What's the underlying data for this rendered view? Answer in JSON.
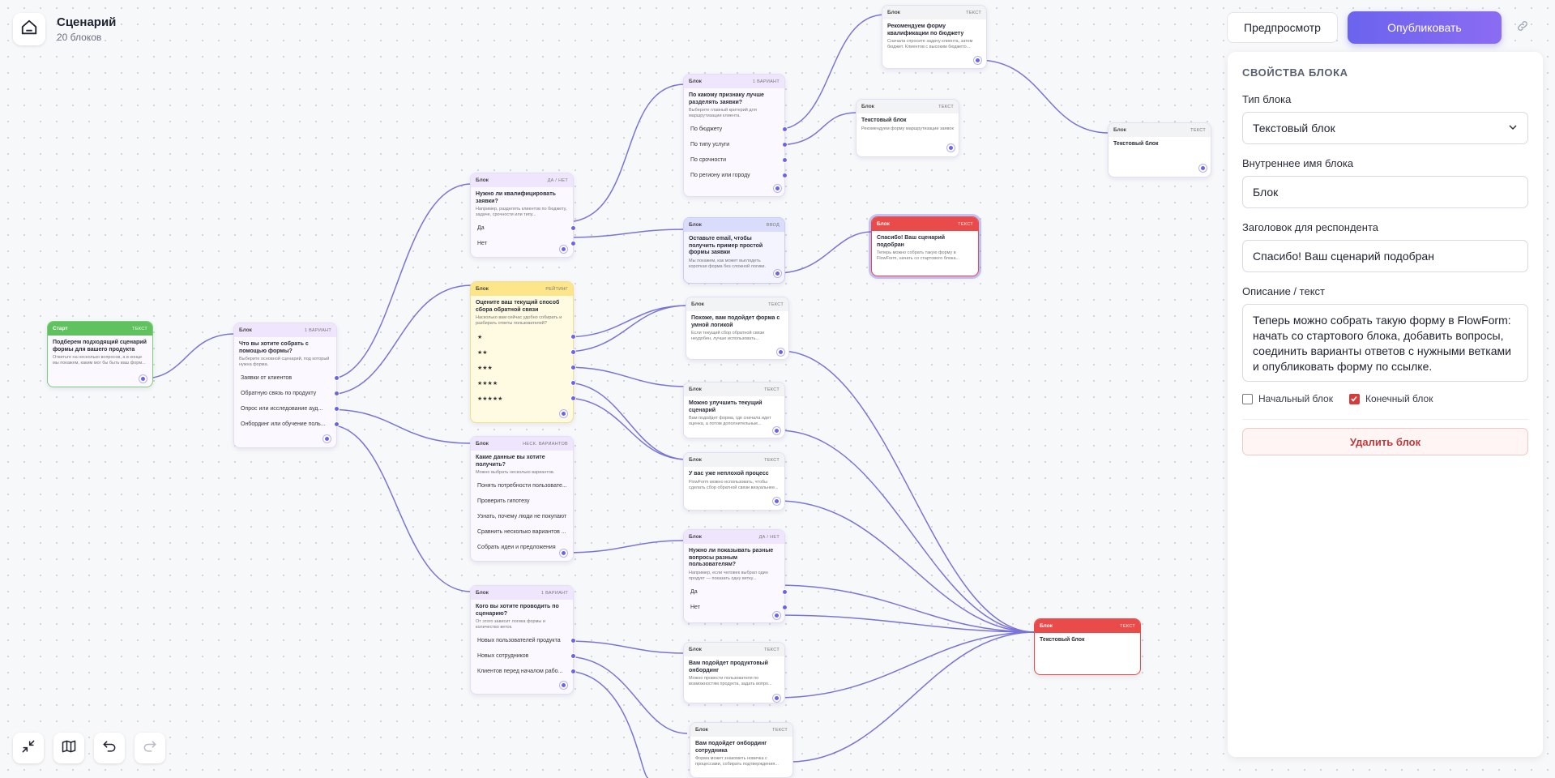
{
  "header": {
    "title": "Сценарий",
    "subtitle": "20 блоков"
  },
  "actions": {
    "preview": "Предпросмотр",
    "publish": "Опубликовать"
  },
  "panel": {
    "title": "СВОЙСТВА БЛОКА",
    "type_label": "Тип блока",
    "type_value": "Текстовый блок",
    "internal_label": "Внутреннее имя блока",
    "internal_value": "Блок",
    "heading_label": "Заголовок для респондента",
    "heading_value": "Спасибо! Ваш сценарий подобран",
    "desc_label": "Описание / текст",
    "desc_value": "Теперь можно собрать такую форму в FlowForm: начать со стартового блока, добавить вопросы, соединить варианты ответов с нужными ветками и опубликовать форму по ссылке.",
    "start_label": "Начальный блок",
    "end_label": "Конечный блок",
    "start_checked": false,
    "end_checked": true,
    "delete_label": "Удалить блок"
  },
  "colors": {
    "accent": "#6b63ee",
    "danger": "#e94b4b",
    "start": "#5fc25f"
  },
  "nodes": {
    "n_start": {
      "badge": "Старт",
      "tag": "ТЕКСТ",
      "q": "Подберем подходящий сценарий формы для вашего продукта",
      "d": "Ответьте на несколько вопросов, а в конце мы покажем, каким мог бы быть ваш форм..."
    },
    "n1": {
      "badge": "Блок",
      "tag": "1 ВАРИАНТ",
      "q": "Что вы хотите собрать с помощью формы?",
      "d": "Выберите основной сценарий, под который нужна форма.",
      "opts": [
        "Заявки от клиентов",
        "Обратную связь по продукту",
        "Опрос или исследование ауд...",
        "Онбординг или обучение поль..."
      ]
    },
    "n2": {
      "badge": "Блок",
      "tag": "ДА / НЕТ",
      "q": "Нужно ли квалифицировать заявки?",
      "d": "Например, разделять клиентов по бюджету, задаче, срочности или типу...",
      "opts": [
        "Да",
        "Нет"
      ]
    },
    "n3": {
      "badge": "Блок",
      "tag": "РЕЙТИНГ",
      "q": "Оцените ваш текущий способ сбора обратной связи",
      "d": "Насколько вам сейчас удобно собирать и разбирать ответы пользователей?",
      "opts": [
        "★",
        "★★",
        "★★★",
        "★★★★",
        "★★★★★"
      ]
    },
    "n4": {
      "badge": "Блок",
      "tag": "НЕСК. ВАРИАНТОВ",
      "q": "Какие данные вы хотите получить?",
      "d": "Можно выбрать несколько вариантов.",
      "opts": [
        "Понять потребности пользовате...",
        "Проверить гипотезу",
        "Узнать, почему люди не покупают",
        "Сравнить несколько вариантов ...",
        "Собрать идеи и предложения"
      ]
    },
    "n5": {
      "badge": "Блок",
      "tag": "1 ВАРИАНТ",
      "q": "Кого вы хотите проводить по сценарию?",
      "d": "От этого зависит логика формы и количество веток.",
      "opts": [
        "Новых пользователей продукта",
        "Новых сотрудников",
        "Клиентов перед началом рабо..."
      ]
    },
    "n6": {
      "badge": "Блок",
      "tag": "1 ВАРИАНТ",
      "q": "По какому признаку лучше разделять заявки?",
      "d": "Выберите главный критерий для маршрутизации клиента.",
      "opts": [
        "По бюджету",
        "По типу услуги",
        "По срочности",
        "По региону или городу"
      ]
    },
    "n7": {
      "badge": "Блок",
      "tag": "ВВОД",
      "q": "Оставьте email, чтобы получить пример простой формы заявки",
      "d": "Мы покажем, как может выглядеть короткая форма без сложной логики."
    },
    "n8": {
      "badge": "Блок",
      "tag": "ТЕКСТ",
      "q": "Похоже, вам подойдет форма с умной логикой",
      "d": "Если текущий сбор обратной связи неудобен, лучше использовать..."
    },
    "n9": {
      "badge": "Блок",
      "tag": "ТЕКСТ",
      "q": "Можно улучшить текущий сценарий",
      "d": "Вам подойдет форма, где сначала идет оценка, а потом дополнительные..."
    },
    "n10": {
      "badge": "Блок",
      "tag": "ТЕКСТ",
      "q": "У вас уже неплохой процесс",
      "d": "FlowForm можно использовать, чтобы сделать сбор обратной связи визуальнее..."
    },
    "n11": {
      "badge": "Блок",
      "tag": "ДА / НЕТ",
      "q": "Нужно ли показывать разные вопросы разным пользователям?",
      "d": "Например, если человек выбрал один продукт — показать одну ветку...",
      "opts": [
        "Да",
        "Нет"
      ]
    },
    "n12": {
      "badge": "Блок",
      "tag": "ТЕКСТ",
      "q": "Вам подойдет продуктовый онбординг",
      "d": "Можно провести пользователя по возможностям продукта, задать вопро..."
    },
    "n13": {
      "badge": "Блок",
      "tag": "ТЕКСТ",
      "q": "Вам подойдет онбординг сотрудника",
      "d": "Форма может знакомить новичка с процессами, собирать подтверждения..."
    },
    "n14": {
      "badge": "Блок",
      "tag": "ТЕКСТ",
      "q": "Рекомендуем форму квалификации по бюджету",
      "d": "Сначала спросите задачу клиента, затем бюджет. Клиентов с высоким бюджето..."
    },
    "n15": {
      "badge": "Блок",
      "tag": "ТЕКСТ",
      "q": "Текстовый блок",
      "d": "Рекомендуем форму маршрутизации заявок"
    },
    "n16": {
      "badge": "Блок",
      "tag": "ТЕКСТ",
      "q": "Текстовый блок",
      "d": ""
    },
    "n17": {
      "badge": "Блок",
      "tag": "ТЕКСТ",
      "q": "Спасибо! Ваш сценарий подобран",
      "d": "Теперь можно собрать такую форму в FlowForm, начать со стартового блока..."
    },
    "n18": {
      "badge": "Блок",
      "tag": "ТЕКСТ",
      "q": "Текстовый блок",
      "d": ""
    }
  }
}
